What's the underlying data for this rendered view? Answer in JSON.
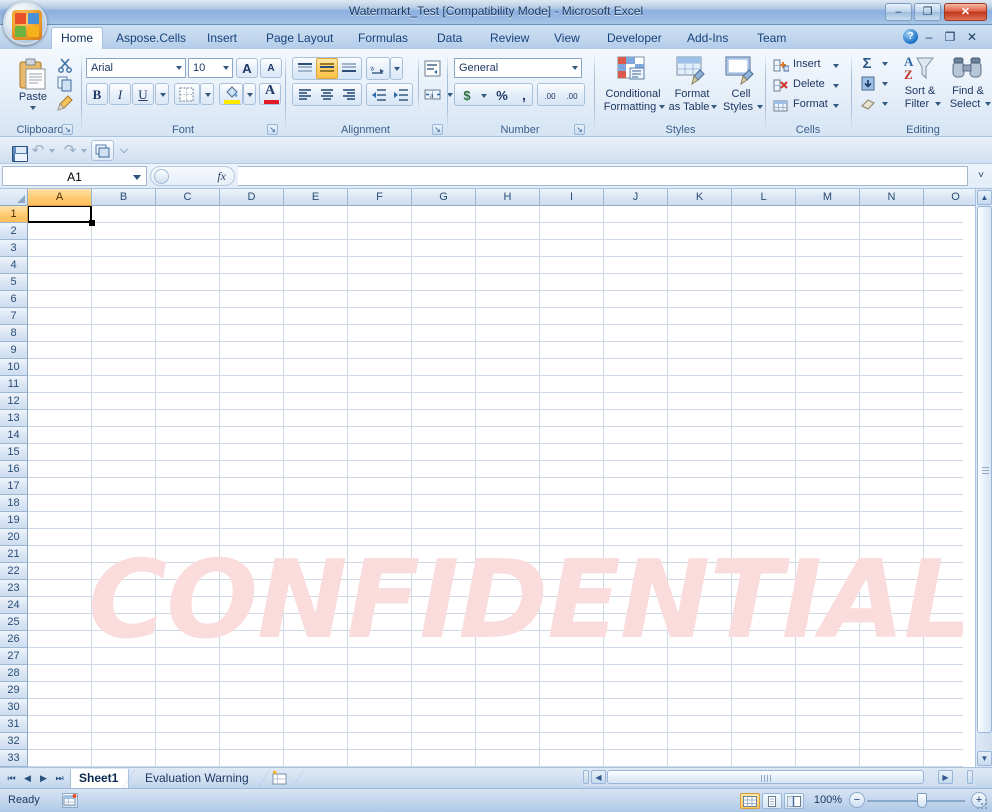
{
  "window": {
    "title": "Watermarkt_Test  [Compatibility Mode] - Microsoft Excel",
    "minimize": "–",
    "maximize": "❐",
    "close": "✕"
  },
  "office_button": {
    "name": "Office Button"
  },
  "ribbon": {
    "tabs": [
      {
        "label": "Home",
        "active": true
      },
      {
        "label": "Aspose.Cells",
        "active": false
      },
      {
        "label": "Insert",
        "active": false
      },
      {
        "label": "Page Layout",
        "active": false
      },
      {
        "label": "Formulas",
        "active": false
      },
      {
        "label": "Data",
        "active": false
      },
      {
        "label": "Review",
        "active": false
      },
      {
        "label": "View",
        "active": false
      },
      {
        "label": "Developer",
        "active": false
      },
      {
        "label": "Add-Ins",
        "active": false
      },
      {
        "label": "Team",
        "active": false
      }
    ],
    "help_label": "?",
    "ribbon_minimize": "–",
    "ribbon_restore": "❐",
    "ribbon_close": "✕",
    "groups": {
      "clipboard": {
        "title": "Clipboard",
        "paste_label": "Paste",
        "cut_label": "Cut",
        "copy_label": "Copy",
        "format_painter_label": "Format Painter",
        "dialog_launcher": "↘"
      },
      "font": {
        "title": "Font",
        "font_name": "Arial",
        "font_size": "10",
        "grow_font": "A",
        "shrink_font": "A",
        "bold": "B",
        "italic": "I",
        "underline": "U",
        "borders_label": "Borders",
        "fill_color_label": "Fill Color",
        "font_color_label": "Font Color",
        "dialog_launcher": "↘"
      },
      "alignment": {
        "title": "Alignment",
        "align_top": "Top Align",
        "align_middle": "Middle Align",
        "align_bottom": "Bottom Align",
        "orientation": "Orientation",
        "align_left": "Align Text Left",
        "align_center": "Center",
        "align_right": "Align Text Right",
        "decrease_indent": "Decrease Indent",
        "increase_indent": "Increase Indent",
        "wrap_text": "Wrap Text",
        "merge_center": "Merge & Center",
        "dialog_launcher": "↘"
      },
      "number": {
        "title": "Number",
        "format": "General",
        "accounting": "$",
        "percent": "%",
        "comma": ",",
        "increase_decimal": ".00",
        "decrease_decimal": ".00",
        "dialog_launcher": "↘"
      },
      "styles": {
        "title": "Styles",
        "conditional_formatting": "Conditional\nFormatting",
        "conditional_formatting_l1": "Conditional",
        "conditional_formatting_l2": "Formatting",
        "format_as_table_l1": "Format",
        "format_as_table_l2": "as Table",
        "cell_styles_l1": "Cell",
        "cell_styles_l2": "Styles"
      },
      "cells": {
        "title": "Cells",
        "insert": "Insert",
        "delete": "Delete",
        "format": "Format"
      },
      "editing": {
        "title": "Editing",
        "autosum": "Σ",
        "fill": "Fill",
        "clear": "Clear",
        "sort_filter_l1": "Sort &",
        "sort_filter_l2": "Filter",
        "find_select_l1": "Find &",
        "find_select_l2": "Select"
      }
    }
  },
  "qat": {
    "save": "Save",
    "undo": "↶",
    "redo": "↷",
    "print_preview": "Print Preview",
    "customize": "⌵"
  },
  "formula_bar": {
    "name_box_value": "A1",
    "fx_label": "fx",
    "formula_value": "",
    "expand_label": "˅"
  },
  "grid": {
    "columns": [
      "A",
      "B",
      "C",
      "D",
      "E",
      "F",
      "G",
      "H",
      "I",
      "J",
      "K",
      "L",
      "M",
      "N",
      "O"
    ],
    "rows": [
      1,
      2,
      3,
      4,
      5,
      6,
      7,
      8,
      9,
      10,
      11,
      12,
      13,
      14,
      15,
      16,
      17,
      18,
      19,
      20,
      21,
      22,
      23,
      24,
      25,
      26,
      27,
      28,
      29,
      30,
      31,
      32,
      33
    ],
    "selected_cell": "A1",
    "selected_column": "A",
    "selected_row": 1,
    "watermark_text": "CONFIDENTIAL",
    "watermark_color": "#fbdcdc"
  },
  "sheet_tabs": {
    "first_label": "⏮",
    "prev_label": "◀",
    "next_label": "▶",
    "last_label": "⏭",
    "tabs": [
      {
        "label": "Sheet1",
        "active": true
      },
      {
        "label": "Evaluation Warning",
        "active": false
      }
    ],
    "insert_sheet_label": "Insert Worksheet"
  },
  "status_bar": {
    "mode": "Ready",
    "macro_record_label": "Record Macro",
    "view_normal": "Normal",
    "view_page_layout": "Page Layout",
    "view_page_break": "Page Break Preview",
    "zoom_value": "100%",
    "zoom_out": "−",
    "zoom_in": "+"
  },
  "scrollbars": {
    "v_up": "▲",
    "v_down": "▼",
    "h_left": "◀",
    "h_right": "▶"
  }
}
